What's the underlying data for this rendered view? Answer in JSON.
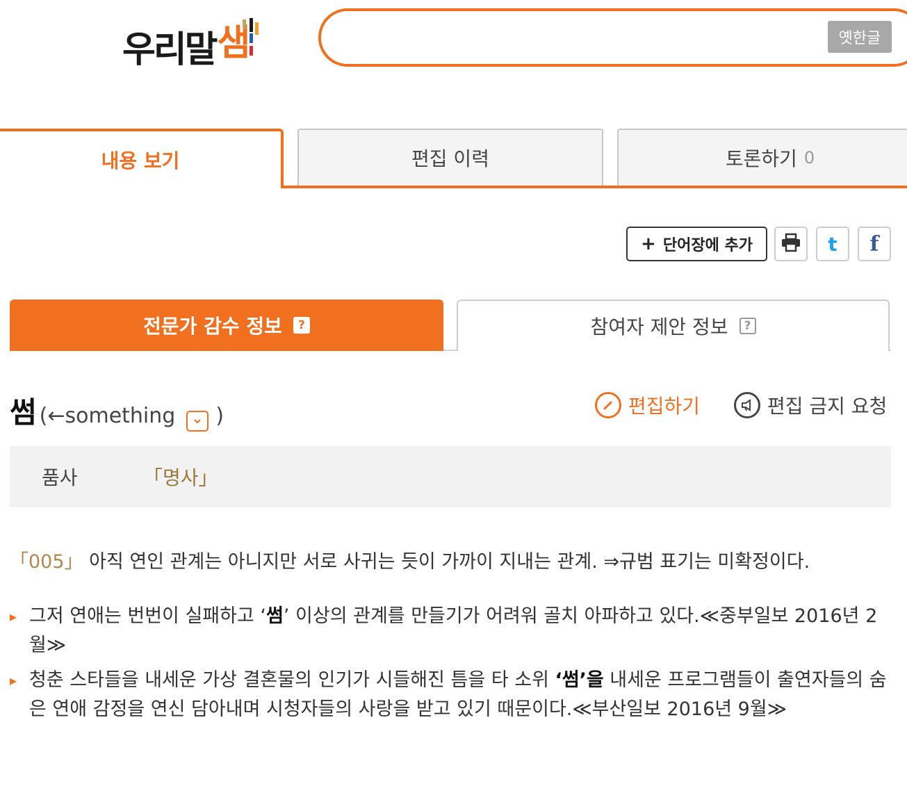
{
  "header": {
    "logo_text": "우리말",
    "logo_mark": "샘",
    "search_placeholder": "",
    "old_hangul_label": "옛한글"
  },
  "tabs": [
    {
      "label": "내용 보기",
      "active": true
    },
    {
      "label": "편집 이력",
      "active": false
    },
    {
      "label": "토론하기",
      "count": "0",
      "active": false
    }
  ],
  "actions": {
    "add_word_plus": "+",
    "add_word_label": "단어장에 추가",
    "twitter_glyph": "t",
    "facebook_glyph": "f"
  },
  "info_tabs": {
    "expert": {
      "label": "전문가 감수 정보",
      "help": "?"
    },
    "user": {
      "label": "참여자 제안 정보",
      "help": "?"
    }
  },
  "entry": {
    "headword": "썸",
    "origin_open": "(←",
    "origin_word": "something",
    "origin_close": ")",
    "edit_label": "편집하기",
    "block_label": "편집 금지 요청",
    "pos_label": "품사",
    "pos_value": "「명사」",
    "definition_number": "「005」",
    "definition_text": " 아직 연인 관계는 아니지만 서로 사귀는 듯이 가까이 지내는 관계. ⇒규범 표기는 미확정이다.",
    "examples": [
      {
        "before": "그저 연애는 번번이 실패하고 ‘",
        "bold": "썸",
        "after": "’ 이상의 관계를 만들기가 어려워 골치 아파하고 있다.≪중부일보 2016년 2월≫"
      },
      {
        "before": "청춘 스타들을 내세운 가상 결혼물의 인기가 시들해진 틈을 타 소위 ",
        "bold": "‘썸’을",
        "after": " 내세운 프로그램들이 출연자들의 숨은 연애 감정을 연신 담아내며 시청자들의 사랑을 받고 있기 때문이다.≪부산일보 2016년 9월≫"
      }
    ]
  },
  "colors": {
    "accent": "#f07020",
    "pos_value": "#9a7a3a",
    "twitter": "#1da1f2",
    "facebook": "#3b5998"
  }
}
